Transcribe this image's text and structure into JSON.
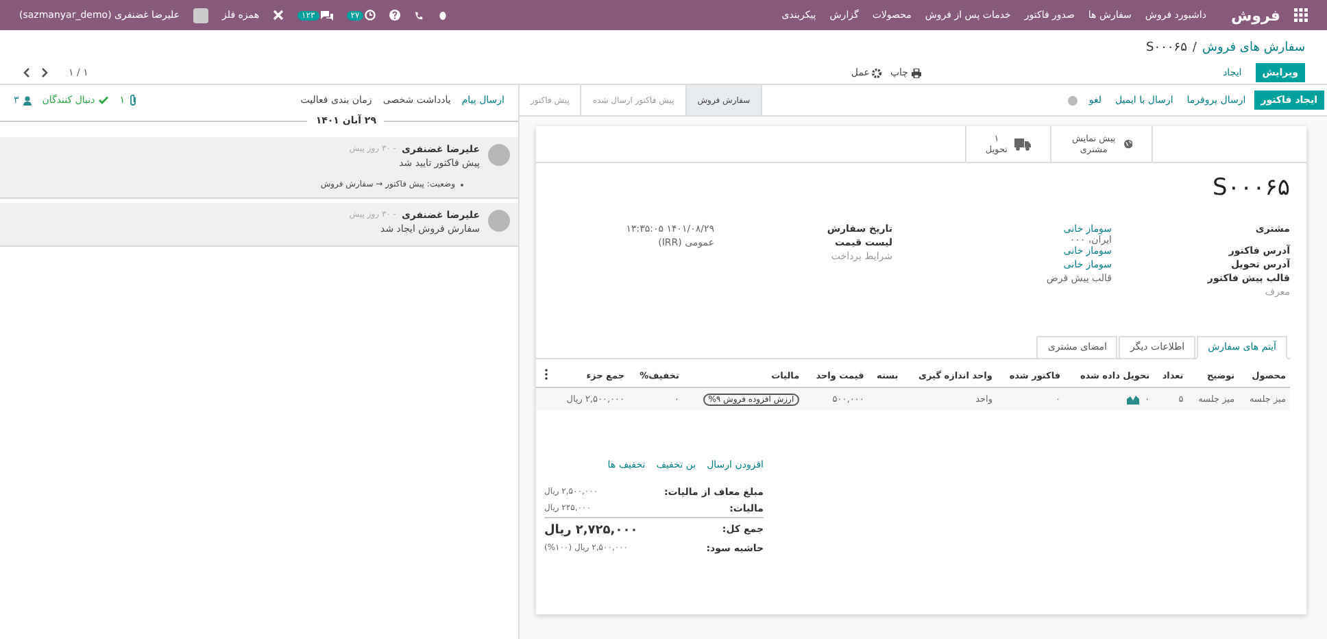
{
  "navbar": {
    "brand": "فروش",
    "menu": [
      "داشبورد فروش",
      "سفارش ها",
      "صدور فاکتور",
      "خدمات پس از فروش",
      "محصولات",
      "گزارش",
      "پیکربندی"
    ],
    "user": "علیرضا غضنفری (sazmanyar_demo)",
    "company": "همزه فلز",
    "chat_count": "۱۲۳",
    "activity_count": "۲۷"
  },
  "breadcrumb": {
    "parent": "سفارش های فروش",
    "separator": "/",
    "current": "S۰۰۰۶۵"
  },
  "actions": {
    "edit": "ویرایش",
    "create": "ایجاد",
    "print": "چاپ",
    "action": "عمل",
    "pager": "۱ / ۱"
  },
  "form_buttons": [
    {
      "label": "ایجاد فاکتور",
      "kind": "primary"
    },
    {
      "label": "ارسال پروفرما",
      "kind": "link"
    },
    {
      "label": "ارسال با ایمیل",
      "kind": "link"
    },
    {
      "label": "لغو",
      "kind": "link"
    }
  ],
  "statusbar": [
    {
      "label": "سفارش فروش",
      "selected": true
    },
    {
      "label": "پیش فاکتور ارسال شده",
      "selected": false
    },
    {
      "label": "پیش فاکتور",
      "selected": false
    }
  ],
  "smart_buttons": [
    {
      "kind": "preview",
      "label": "پیش نمایش مشتری"
    },
    {
      "kind": "delivery",
      "count": "۱",
      "label": "تحویل"
    }
  ],
  "title": "S۰۰۰۶۵",
  "fields_left": [
    {
      "label": "مشتری",
      "value": "سوماز خانی",
      "extra": "ایران، ۰۰۰",
      "kind": "link"
    },
    {
      "label": "آدرس فاکتور",
      "value": "سوماز خانی",
      "kind": "link"
    },
    {
      "label": "آدرس تحویل",
      "value": "سوماز خانی",
      "kind": "link"
    },
    {
      "label": "قالب پیش فاکتور",
      "value": "قالب پیش فرض",
      "kind": "text"
    },
    {
      "label": "معرف",
      "kind": "empty"
    }
  ],
  "fields_right": [
    {
      "label": "تاریخ سفارش",
      "value": "۱۴۰۱/۰۸/۲۹ ۱۳:۳۵:۰۵",
      "kind": "text"
    },
    {
      "label": "لیست قیمت",
      "value": "عمومی (IRR)",
      "kind": "text"
    },
    {
      "label": "شرایط پرداخت",
      "kind": "empty"
    }
  ],
  "tabs": [
    {
      "label": "آیتم های سفارش",
      "selected": true
    },
    {
      "label": "اطلاعات دیگر",
      "selected": false
    },
    {
      "label": "امضای مشتری",
      "selected": false
    }
  ],
  "table": {
    "columns": [
      "محصول",
      "توضیح",
      "تعداد",
      "تحویل داده شده",
      "فاکتور شده",
      "واحد اندازه گیری",
      "بسته",
      "قیمت واحد",
      "مالیات",
      "تخفیف%",
      "جمع جزء"
    ],
    "rows": [
      {
        "product": "میز جلسه",
        "description": "میز جلسه",
        "quantity": "۵",
        "delivered": "۰",
        "invoiced": "۰",
        "uom": "واحد",
        "unit_price": "۵۰۰,۰۰۰",
        "tax": "ارزش افزوده فروش ۹%",
        "discount": "۰",
        "subtotal": "۲,۵۰۰,۰۰۰ ریال"
      }
    ]
  },
  "promo_links": [
    "افزودن ارسال",
    "بن تخفیف",
    "تخفیف ها"
  ],
  "totals": [
    {
      "label": "مبلغ معاف از مالیات:",
      "value": "۲,۵۰۰,۰۰۰ ریال",
      "kind": "normal"
    },
    {
      "label": "مالیات:",
      "value": "۲۲۵,۰۰۰ ریال",
      "kind": "normal"
    },
    {
      "label": "جمع کل:",
      "value": "۲,۷۲۵,۰۰۰ ریال",
      "kind": "total"
    },
    {
      "label": "حاشیه سود:",
      "value": "۲,۵۰۰,۰۰۰ ریال (۱۰۰%)",
      "kind": "normal"
    }
  ],
  "chatter": {
    "buttons": [
      "ارسال پیام",
      "یادداشت شخصی",
      "زمان بندی فعالیت"
    ],
    "attachments": "۱",
    "follow": "دنبال کنندگان",
    "followers": "۳",
    "date": "۲۹ آبان ۱۴۰۱",
    "messages": [
      {
        "author": "علیرضا غضنفری",
        "time": "- ۳۰ روز پیش",
        "body": "پیش فاکتور تایید شد",
        "tracking": "وضعیت: پیش فاکتور → سفارش فروش"
      },
      {
        "author": "علیرضا غضنفری",
        "time": "- ۳۰ روز پیش",
        "body": "سفارش فروش ایجاد شد"
      }
    ]
  }
}
